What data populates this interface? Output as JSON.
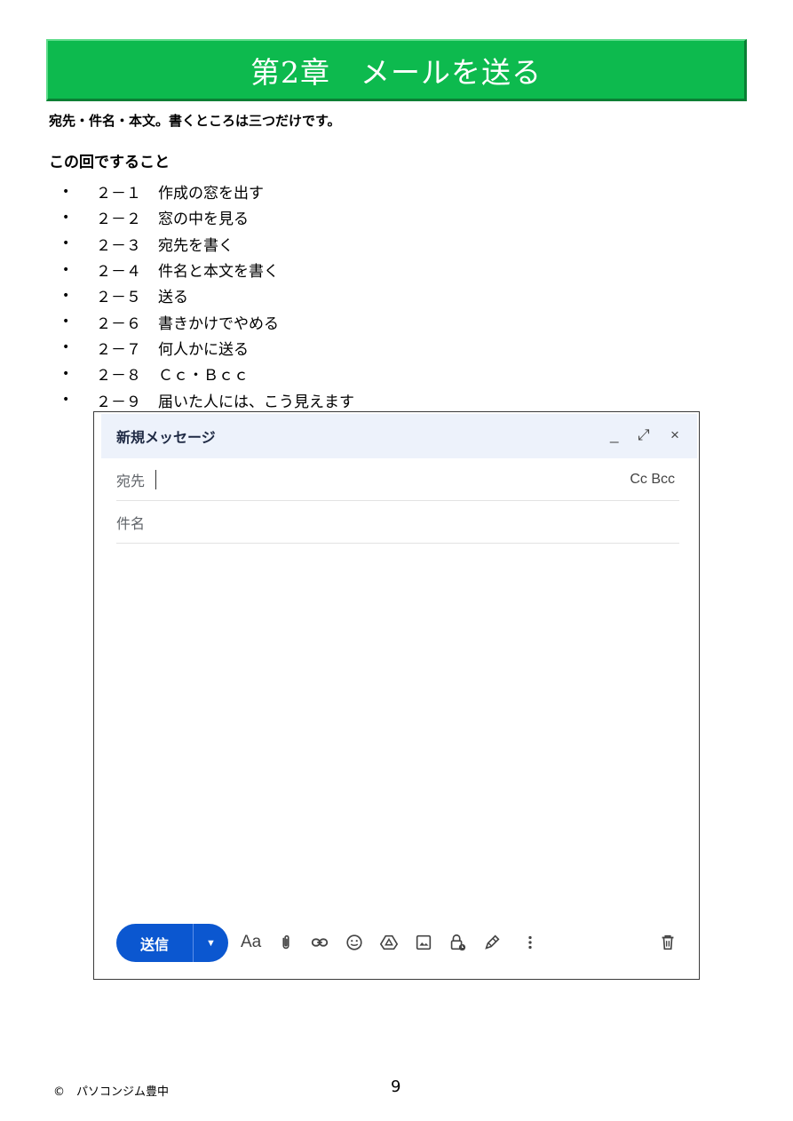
{
  "chapter": {
    "title": "第2章　メールを送る"
  },
  "subtitle": "宛先・件名・本文。書くところは三つだけです。",
  "section_title": "この回ですること",
  "toc": [
    {
      "num": "２－１",
      "text": "作成の窓を出す"
    },
    {
      "num": "２－２",
      "text": "窓の中を見る"
    },
    {
      "num": "２－３",
      "text": "宛先を書く"
    },
    {
      "num": "２－４",
      "text": "件名と本文を書く"
    },
    {
      "num": "２－５",
      "text": "送る"
    },
    {
      "num": "２－６",
      "text": "書きかけでやめる"
    },
    {
      "num": "２－７",
      "text": "何人かに送る"
    },
    {
      "num": "２－８",
      "text": "Ｃｃ・Ｂｃｃ"
    },
    {
      "num": "２－９",
      "text": "届いた人には、こう見えます"
    }
  ],
  "compose": {
    "window_title": "新規メッセージ",
    "controls": {
      "minimize": "_",
      "expand": "⤢",
      "close": "×"
    },
    "to_label": "宛先",
    "cc_bcc_label": "Cc Bcc",
    "subject_placeholder": "件名",
    "send_label": "送信",
    "format_label": "Aa",
    "colors": {
      "send_button": "#0b57d0",
      "titlebar": "#edf2fb",
      "banner": "#0dba4e"
    },
    "toolbar_icons": [
      "formatting-icon",
      "attach-icon",
      "link-icon",
      "emoji-icon",
      "drive-icon",
      "photo-icon",
      "confidential-lock-icon",
      "signature-pen-icon",
      "more-options-icon",
      "discard-trash-icon"
    ]
  },
  "footer": {
    "copyright": "©　パソコンジム豊中",
    "page_number": "9"
  }
}
